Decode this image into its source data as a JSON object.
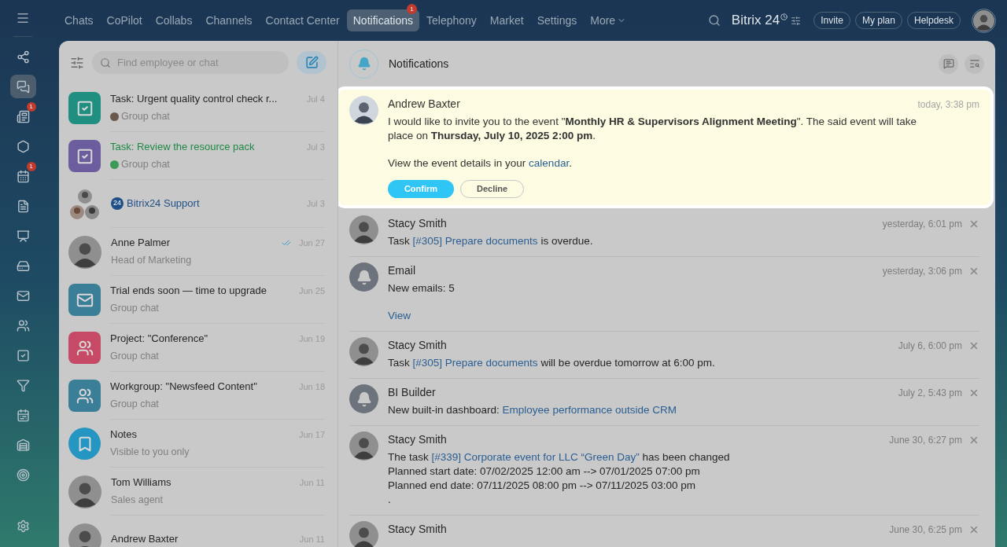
{
  "top_nav": {
    "items": [
      {
        "label": "Chats",
        "selected": false
      },
      {
        "label": "CoPilot",
        "selected": false
      },
      {
        "label": "Collabs",
        "selected": false
      },
      {
        "label": "Channels",
        "selected": false
      },
      {
        "label": "Contact Center",
        "selected": false
      },
      {
        "label": "Notifications",
        "selected": true,
        "badge": "1"
      },
      {
        "label": "Telephony",
        "selected": false
      },
      {
        "label": "Market",
        "selected": false
      },
      {
        "label": "Settings",
        "selected": false
      },
      {
        "label": "More",
        "selected": false,
        "dropdown": true
      }
    ],
    "logo": "Bitrix 24",
    "buttons": [
      "Invite",
      "My plan",
      "Helpdesk"
    ]
  },
  "rail": {
    "items": [
      {
        "selected": false
      },
      {
        "selected": true
      },
      {
        "selected": false,
        "badge": "1"
      },
      {
        "selected": false
      },
      {
        "selected": false,
        "badge": "1"
      },
      {
        "selected": false
      },
      {
        "selected": false
      },
      {
        "selected": false
      },
      {
        "selected": false
      },
      {
        "selected": false
      },
      {
        "selected": false
      },
      {
        "selected": false
      },
      {
        "selected": false
      },
      {
        "selected": false
      },
      {
        "selected": false
      }
    ]
  },
  "chat_list": {
    "search": {
      "placeholder": "Find employee or chat"
    },
    "items": [
      {
        "kind": "task",
        "color": "#1f8f82",
        "title": "Task: Urgent quality control check r...",
        "subtitle": "Group chat",
        "date": "Jul 4",
        "sub_avatar": {
          "color": "#6a584c"
        }
      },
      {
        "kind": "task",
        "color": "#6c5d9e",
        "title": "Task: Review the resource pack",
        "accent": {
          "color": "#1f8a45"
        },
        "subtitle": "Group chat",
        "date": "Jul 3",
        "sub_avatar": {
          "color": "#3b9a55"
        }
      },
      {
        "kind": "people",
        "title": "Bitrix24 Support",
        "accent": {
          "color": "#1f4f87"
        },
        "title_badge": "24",
        "date": "Jul 3"
      },
      {
        "kind": "person",
        "title": "Anne Palmer",
        "subtitle": "Head of Marketing",
        "date": "Jun 27",
        "read": true
      },
      {
        "kind": "mail",
        "color": "#3a7e98",
        "title": "Trial ends soon — time to upgrade",
        "subtitle": "Group chat",
        "date": "Jun 25"
      },
      {
        "kind": "group",
        "color": "#c64a66",
        "title": "Project: \"Conference\"",
        "subtitle": "Group chat",
        "date": "Jun 19"
      },
      {
        "kind": "group",
        "color": "#3a7e98",
        "title": "Workgroup: \"Newsfeed Content\"",
        "subtitle": "Group chat",
        "date": "Jun 18"
      },
      {
        "kind": "notes",
        "color": "#2596c2",
        "title": "Notes",
        "subtitle": "Visible to you only",
        "date": "Jun 17"
      },
      {
        "kind": "person",
        "title": "Tom Williams",
        "subtitle": "Sales agent",
        "date": "Jun 11"
      },
      {
        "kind": "person",
        "title": "Andrew Baxter",
        "date": "Jun 11"
      }
    ]
  },
  "notifications": {
    "title": "Notifications",
    "items": [
      {
        "highlighted": true,
        "kind": "person",
        "name": "Andrew Baxter",
        "time": "today, 3:38 pm",
        "lines": [
          [
            {
              "kind": "text",
              "text": "I would like to invite you to the event \"**Monthly HR & Supervisors Alignment Meeting**\". The said event will take place on **Thursday, July 10, 2025 2:00 pm**."
            }
          ],
          [
            {
              "kind": "text",
              "text": "View the event details in your "
            },
            {
              "kind": "link",
              "text": "calendar"
            },
            {
              "kind": "text",
              "text": "."
            }
          ]
        ],
        "actions": [
          {
            "label": "Confirm",
            "primary": true
          },
          {
            "label": "Decline",
            "primary": false
          }
        ]
      },
      {
        "highlighted": false,
        "kind": "person",
        "name": "Stacy Smith",
        "time": "yesterday, 6:01 pm",
        "lines": [
          [
            {
              "kind": "text",
              "text": "Task "
            },
            {
              "kind": "link",
              "text": "[#305] Prepare documents"
            },
            {
              "kind": "text",
              "text": " is overdue."
            }
          ]
        ]
      },
      {
        "highlighted": false,
        "kind": "bell",
        "name": "Email",
        "time": "yesterday, 3:06 pm",
        "lines": [
          [
            {
              "kind": "text",
              "text": "New emails: 5"
            }
          ],
          [
            {
              "kind": "link",
              "text": "View"
            }
          ]
        ]
      },
      {
        "highlighted": false,
        "kind": "person",
        "name": "Stacy Smith",
        "time": "July 6, 6:00 pm",
        "lines": [
          [
            {
              "kind": "text",
              "text": "Task "
            },
            {
              "kind": "link",
              "text": "[#305] Prepare documents"
            },
            {
              "kind": "text",
              "text": " will be overdue tomorrow at 6:00 pm."
            }
          ]
        ]
      },
      {
        "highlighted": false,
        "kind": "bell",
        "name": "BI Builder",
        "time": "July 2, 5:43 pm",
        "lines": [
          [
            {
              "kind": "text",
              "text": "New built-in dashboard: "
            },
            {
              "kind": "link",
              "text": "Employee performance outside CRM"
            }
          ]
        ]
      },
      {
        "highlighted": false,
        "kind": "person",
        "name": "Stacy Smith",
        "time": "June 30, 6:27 pm",
        "lines": [
          [
            {
              "kind": "text",
              "text": "The task "
            },
            {
              "kind": "link",
              "text": "[#339] Corporate event for LLC “Green Day”"
            },
            {
              "kind": "text",
              "text": " has been changed"
            }
          ],
          [
            {
              "kind": "text",
              "text": "Planned start date: 07/02/2025 12:00 am --> 07/01/2025 07:00 pm"
            }
          ],
          [
            {
              "kind": "text",
              "text": "Planned end date: 07/11/2025 08:00 pm --> 07/11/2025 03:00 pm"
            }
          ],
          [
            {
              "kind": "text",
              "text": "."
            }
          ]
        ]
      },
      {
        "highlighted": false,
        "kind": "person",
        "name": "Stacy Smith",
        "time": "June 30, 6:25 pm"
      }
    ]
  }
}
